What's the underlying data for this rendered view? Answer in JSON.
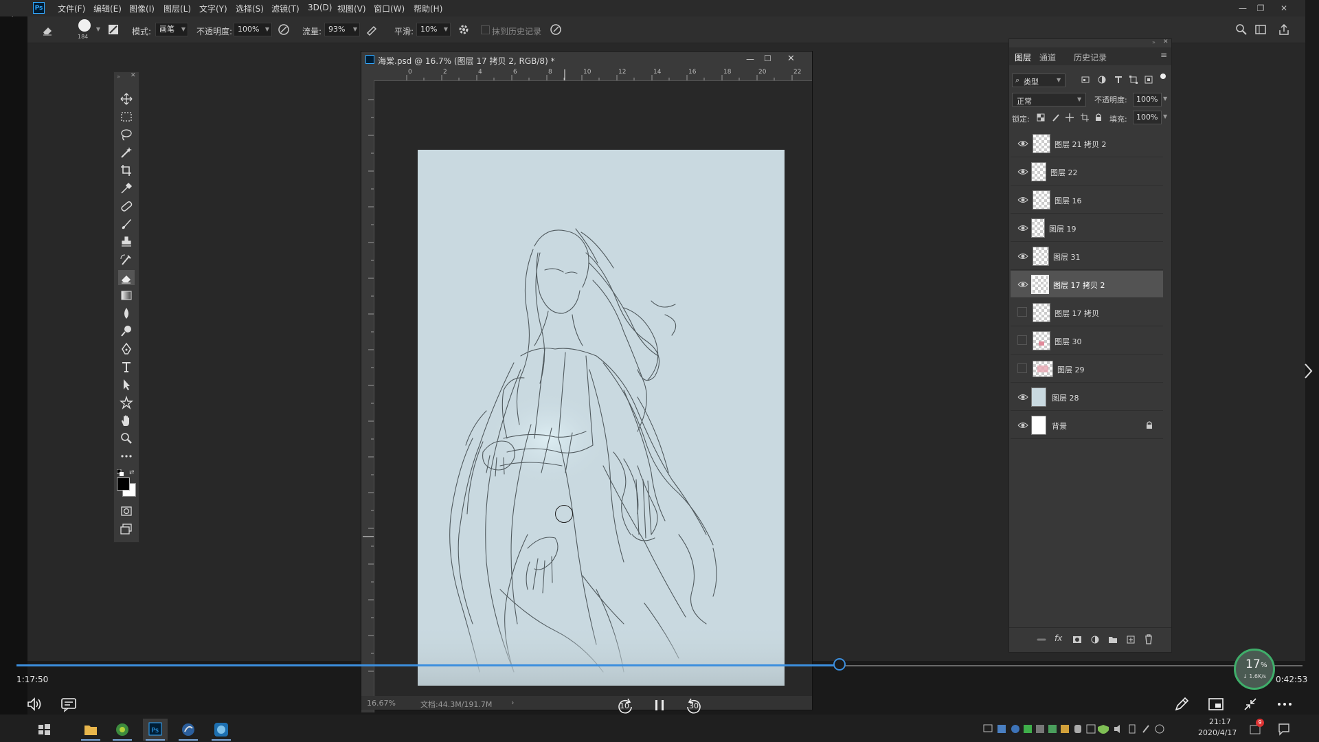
{
  "menubar": {
    "app_badge": "Ps",
    "items": [
      "文件(F)",
      "编辑(E)",
      "图像(I)",
      "图层(L)",
      "文字(Y)",
      "选择(S)",
      "滤镜(T)",
      "3D(D)",
      "视图(V)",
      "窗口(W)",
      "帮助(H)"
    ]
  },
  "options": {
    "brush_size": "184",
    "mode_label": "模式:",
    "mode_value": "画笔",
    "opacity_label": "不透明度:",
    "opacity_value": "100%",
    "flow_label": "流量:",
    "flow_value": "93%",
    "smooth_label": "平滑:",
    "smooth_value": "10%",
    "history_label": "抹到历史记录"
  },
  "document": {
    "title": "海棠.psd @ 16.7% (图层 17 拷贝 2, RGB/8) *",
    "zoom": "16.67%",
    "doc_size": "文档:44.3M/191.7M",
    "ruler_top": [
      "0",
      "2",
      "4",
      "6",
      "8",
      "10",
      "12",
      "14",
      "16",
      "18",
      "20",
      "22"
    ]
  },
  "layers_panel": {
    "tabs": [
      "图层",
      "通道",
      "历史记录"
    ],
    "filter_value": "类型",
    "blend_mode": "正常",
    "opacity_label": "不透明度:",
    "opacity_value": "100%",
    "lock_label": "锁定:",
    "fill_label": "填充:",
    "fill_value": "100%",
    "layers": [
      {
        "name": "图层 21 拷贝 2",
        "visible": true,
        "selected": false
      },
      {
        "name": "图层 22",
        "visible": true,
        "selected": false
      },
      {
        "name": "图层 16",
        "visible": true,
        "selected": false
      },
      {
        "name": "图层 19",
        "visible": true,
        "selected": false
      },
      {
        "name": "图层 31",
        "visible": true,
        "selected": false
      },
      {
        "name": "图层 17 拷贝 2",
        "visible": true,
        "selected": true
      },
      {
        "name": "图层 17 拷贝",
        "visible": false,
        "selected": false
      },
      {
        "name": "图层 30",
        "visible": false,
        "selected": false
      },
      {
        "name": "图层 29",
        "visible": false,
        "selected": false
      },
      {
        "name": "图层 28",
        "visible": true,
        "selected": false
      },
      {
        "name": "背景",
        "visible": true,
        "selected": false
      }
    ]
  },
  "video": {
    "elapsed": "1:17:50",
    "remaining": "0:42:53",
    "progress": 0.64,
    "skip_back": "10",
    "skip_forward": "30"
  },
  "speed_meter": {
    "percent": "17",
    "percent_unit": "%",
    "rate": "↓ 1.6K/s"
  },
  "taskbar": {
    "time": "21:17",
    "date": "2020/4/17",
    "notification_badge": "9"
  },
  "colors": {
    "accent": "#3c8fde",
    "canvas": "#c9d9e0"
  }
}
